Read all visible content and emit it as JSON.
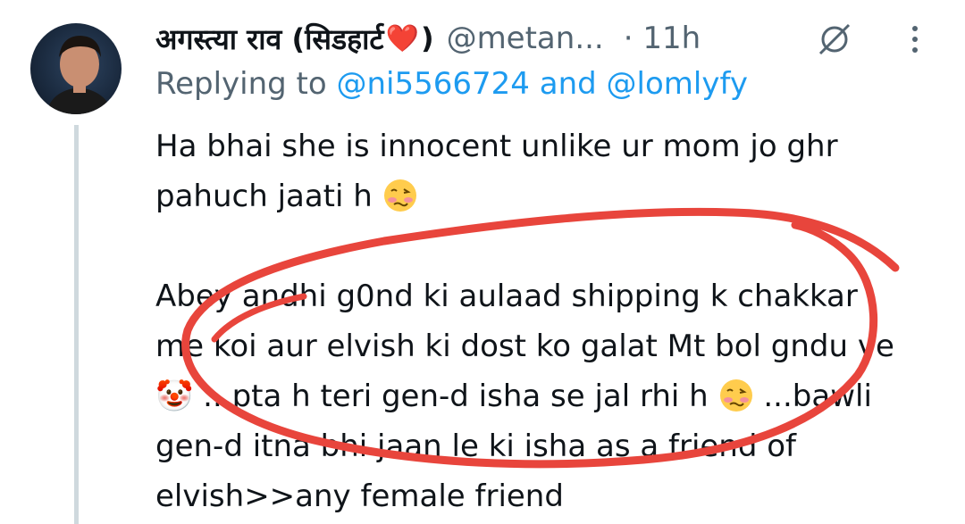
{
  "author": {
    "display_name": "अगस्त्या राव (सिडहार्ट",
    "display_name_suffix": ")",
    "heart": "❤️",
    "handle": "@metan...",
    "time": "· 11h"
  },
  "reply": {
    "prefix": "Replying to ",
    "mention1": "@ni5566724",
    "joiner": " and ",
    "mention2": "@lomlyfy"
  },
  "body": {
    "line1": "Ha bhai she is innocent unlike ur mom jo ghr",
    "line2": "pahuch jaati h",
    "line3": "Abey andhi g0nd ki aulaad shipping k chakkar",
    "line4": "me koi aur elvish ki dost ko galat Mt bol gndu ve",
    "line5_a": "🤡 ...pta h teri gen-d isha se jal rhi h",
    "line5_b": " ...bawli",
    "line6": "gen-d itna bhi jaan le ki isha as a friend of",
    "line7": "elvish>>any female friend"
  },
  "icons": {
    "edit": "no-edit-icon",
    "more": "more-vertical-icon",
    "emoji": "woozy-face-icon"
  },
  "colors": {
    "text": "#0f1419",
    "muted": "#536471",
    "link": "#1d9bf0",
    "scribble": "#e8453c"
  }
}
